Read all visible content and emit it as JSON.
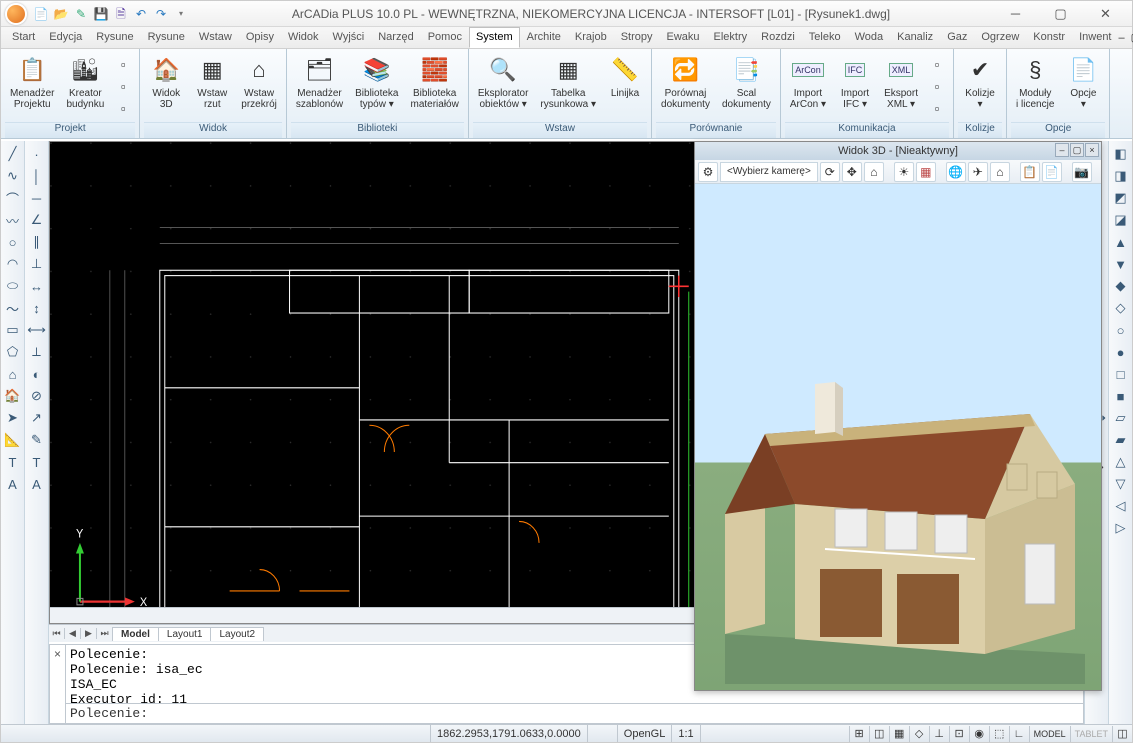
{
  "title": "ArCADia PLUS 10.0 PL - WEWNĘTRZNA, NIEKOMERCYJNA LICENCJA - INTERSOFT [L01] - [Rysunek1.dwg]",
  "qat_icons": [
    "new-icon",
    "open-icon",
    "save-icon",
    "saveall-icon",
    "undo-icon",
    "redo-icon"
  ],
  "tabs": [
    "Start",
    "Edycja",
    "Rysune",
    "Rysune",
    "Wstaw",
    "Opisy",
    "Widok",
    "Wyjści",
    "Narzęd",
    "Pomoc",
    "System",
    "Archite",
    "Krajob",
    "Stropy",
    "Ewaku",
    "Elektry",
    "Rozdzi",
    "Teleko",
    "Woda",
    "Kanaliz",
    "Gaz",
    "Ogrzew",
    "Konstr",
    "Inwent"
  ],
  "active_tab": 10,
  "ribbon": {
    "groups": [
      {
        "label": "Projekt",
        "buttons": [
          {
            "icon": "📋",
            "label": "Menadżer\nProjektu"
          },
          {
            "icon": "🏙",
            "label": "Kreator\nbudynku"
          }
        ],
        "small": [
          "▫",
          "▫",
          "▫"
        ]
      },
      {
        "label": "Widok",
        "buttons": [
          {
            "icon": "🏠",
            "label": "Widok\n3D"
          },
          {
            "icon": "▦",
            "label": "Wstaw\nrzut"
          },
          {
            "icon": "⌂",
            "label": "Wstaw\nprzekrój"
          }
        ]
      },
      {
        "label": "Biblioteki",
        "buttons": [
          {
            "icon": "🗂",
            "label": "Menadżer\nszablonów"
          },
          {
            "icon": "📚",
            "label": "Biblioteka\ntypów ▾"
          },
          {
            "icon": "🧱",
            "label": "Biblioteka\nmateriałów"
          }
        ]
      },
      {
        "label": "Wstaw",
        "buttons": [
          {
            "icon": "🔍",
            "label": "Eksplorator\nobiektów ▾"
          },
          {
            "icon": "▦",
            "label": "Tabelka\nrysunkowa ▾"
          },
          {
            "icon": "📏",
            "label": "Linijka"
          }
        ]
      },
      {
        "label": "Porównanie",
        "buttons": [
          {
            "icon": "🔁",
            "label": "Porównaj\ndokumenty"
          },
          {
            "icon": "📑",
            "label": "Scal\ndokumenty"
          }
        ]
      },
      {
        "label": "Komunikacja",
        "buttons": [
          {
            "icon": "⬇",
            "label": "Import\nArCon ▾",
            "badge": "ArCon"
          },
          {
            "icon": "⬇",
            "label": "Import\nIFC ▾",
            "badge": "IFC"
          },
          {
            "icon": "⬆",
            "label": "Eksport\nXML ▾",
            "badge": "XML"
          }
        ],
        "small": [
          "▫",
          "▫",
          "▫"
        ]
      },
      {
        "label": "Kolizje",
        "buttons": [
          {
            "icon": "✔",
            "label": "Kolizje\n▾"
          }
        ]
      },
      {
        "label": "Opcje",
        "buttons": [
          {
            "icon": "§",
            "label": "Moduły\ni licencje"
          },
          {
            "icon": "📄",
            "label": "Opcje\n▾"
          }
        ]
      }
    ]
  },
  "left_tools1": [
    "line",
    "pline",
    "arc",
    "spline",
    "circ",
    "arc2",
    "ellip",
    "curve",
    "rect",
    "poly",
    "house",
    "home",
    "arrow",
    "meas",
    "text",
    "textA"
  ],
  "left_tools2": [
    "pt",
    "v",
    "h",
    "ang",
    "par",
    "perp",
    "dim",
    "dim2",
    "dim3",
    "ang2",
    "rad",
    "dia",
    "lead",
    "note",
    "txt",
    "A"
  ],
  "right_tools1": [
    "grp",
    "layer",
    "mirror",
    "mirror2",
    "rot",
    "rot2",
    "sc",
    "sc2",
    "arr",
    "arr2",
    "off",
    "tr",
    "ex",
    "pan",
    "zoom",
    "zf"
  ],
  "right_tools2": [
    "a",
    "b",
    "c",
    "d",
    "e",
    "f",
    "g",
    "h",
    "i",
    "j",
    "k",
    "l",
    "m",
    "n",
    "o",
    "p",
    "q",
    "r"
  ],
  "layout_tabs": [
    "Model",
    "Layout1",
    "Layout2"
  ],
  "active_layout": 0,
  "cmd_history": "Polecenie:\nPolecenie: isa_ec\nISA_EC\nExecutor id: 11",
  "cmd_prompt": "Polecenie:",
  "view3d": {
    "title": "Widok 3D - [Nieaktywny]",
    "camera_placeholder": "<Wybierz kamerę>",
    "toolbar_icons": [
      "cog",
      "orbit",
      "pan",
      "reset",
      "sun",
      "wall",
      "globe",
      "plane",
      "house",
      "clip",
      "copy",
      "cam"
    ]
  },
  "status": {
    "coords": "1862.2953,1791.0633,0.0000",
    "segments": [
      "OpenGL",
      "1:1"
    ],
    "indicators": [
      "⊞",
      "◫",
      "▦",
      "◇",
      "⊥",
      "⊡",
      "◉",
      "⬚",
      "∟"
    ],
    "text_btns": [
      "MODEL",
      "TABLET"
    ]
  }
}
